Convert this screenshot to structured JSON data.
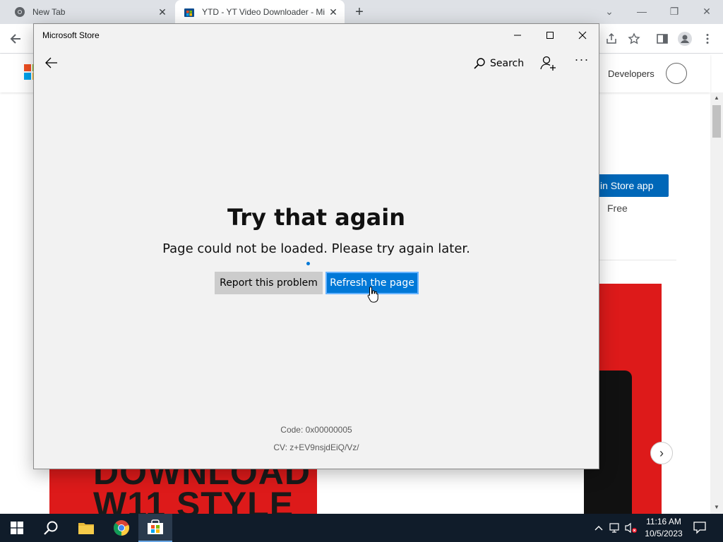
{
  "browser": {
    "tabs": [
      {
        "title": "New Tab"
      },
      {
        "title": "YTD - YT Video Downloader - Mi"
      }
    ],
    "new_tab_symbol": "+",
    "site": {
      "nav_developers": "Developers",
      "get_button": "in Store app",
      "price": "Free",
      "promo_text": "DOWNLOAD\nW11 STYLE"
    }
  },
  "store": {
    "window_title": "Microsoft Store",
    "search_label": "Search",
    "more_label": "···",
    "error": {
      "title": "Try that again",
      "message": "Page could not be loaded. Please try again later.",
      "report_button": "Report this problem",
      "refresh_button": "Refresh the page",
      "code": "Code: 0x00000005",
      "cv": "CV: z+EV9nsjdEiQ/Vz/"
    }
  },
  "taskbar": {
    "time": "11:16 AM",
    "date": "10/5/2023",
    "apps": [
      "start-icon",
      "search-icon",
      "file-explorer-icon",
      "chrome-icon",
      "microsoft-store-icon"
    ]
  },
  "colors": {
    "accent": "#0078d7",
    "store_bg": "#f2f2f2",
    "taskbar_bg": "#101c2a",
    "promo_red": "#dd1a1a"
  }
}
